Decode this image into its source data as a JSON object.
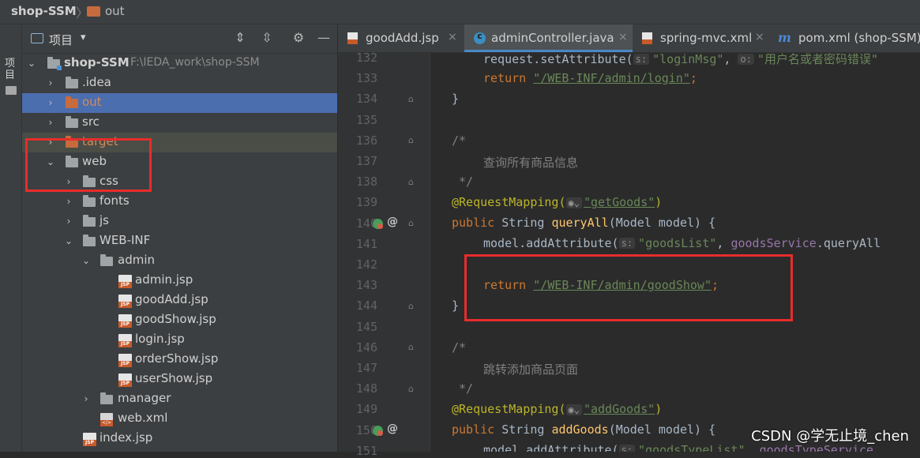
{
  "breadcrumb": {
    "project": "shop-SSM",
    "folder": "out"
  },
  "tool_strip": {
    "label": "项目"
  },
  "project_panel": {
    "title": "项目",
    "dropdown": "▾",
    "root": {
      "name": "shop-SSM",
      "path": "F:\\IEDA_work\\shop-SSM"
    },
    "items": [
      {
        "label": ".idea"
      },
      {
        "label": "out"
      },
      {
        "label": "src"
      },
      {
        "label": "target"
      },
      {
        "label": "web"
      },
      {
        "label": "css"
      },
      {
        "label": "fonts"
      },
      {
        "label": "js"
      },
      {
        "label": "WEB-INF"
      },
      {
        "label": "admin"
      },
      {
        "label": "admin.jsp"
      },
      {
        "label": "goodAdd.jsp"
      },
      {
        "label": "goodShow.jsp"
      },
      {
        "label": "login.jsp"
      },
      {
        "label": "orderShow.jsp"
      },
      {
        "label": "userShow.jsp"
      },
      {
        "label": "manager"
      },
      {
        "label": "web.xml"
      },
      {
        "label": "index.jsp"
      }
    ]
  },
  "editor_tabs": [
    {
      "label": "goodAdd.jsp"
    },
    {
      "label": "adminController.java"
    },
    {
      "label": "spring-mvc.xml"
    },
    {
      "label": "pom.xml (shop-SSM)"
    }
  ],
  "code": {
    "line_numbers": [
      "132",
      "133",
      "134",
      "135",
      "136",
      "137",
      "138",
      "139",
      "140",
      "141",
      "142",
      "143",
      "144",
      "145",
      "146",
      "147",
      "148",
      "149",
      "150",
      "151"
    ],
    "l132_fn": "request.setAttribute(",
    "l132_hint1": "s:",
    "l132_str1": "\"loginMsg\"",
    "l132_sep": ", ",
    "l132_hint2": "o:",
    "l132_str2": "\"用户名或者密码错误\"",
    "l133_kw": "return ",
    "l133_str": "\"/WEB-INF/admin/login\"",
    "l133_end": ";",
    "l134": "}",
    "l136": "/*",
    "l137": "查询所有商品信息",
    "l138": " */",
    "l139_ann": "@RequestMapping(",
    "l139_str": "\"getGoods\"",
    "l139_end": ")",
    "l140_kw": "public ",
    "l140_type": "String ",
    "l140_fn": "queryAll",
    "l140_rest": "(Model model) {",
    "l141_a": "model.addAttribute(",
    "l141_hint": "s:",
    "l141_str": "\"goodsList\"",
    "l141_sep": ", ",
    "l141_fld": "goodsService",
    "l141_b": ".queryAll",
    "l143_kw": "return ",
    "l143_str": "\"/WEB-INF/admin/goodShow\"",
    "l143_end": ";",
    "l144": "}",
    "l146": "/*",
    "l147": "跳转添加商品页面",
    "l148": " */",
    "l149_ann": "@RequestMapping(",
    "l149_str": "\"addGoods\"",
    "l149_end": ")",
    "l150_kw": "public ",
    "l150_type": "String ",
    "l150_fn": "addGoods",
    "l150_rest": "(Model model) {",
    "l151_a": "model.addAttribute(",
    "l151_hint": "s:",
    "l151_str": "\"goodsTypeList\"",
    "l151_sep": ", ",
    "l151_fld": "goodsTypeService"
  },
  "watermark": "CSDN @学无止境_chen",
  "colors": {
    "accent": "#4b6eaf",
    "annotation": "#e82c2c"
  }
}
